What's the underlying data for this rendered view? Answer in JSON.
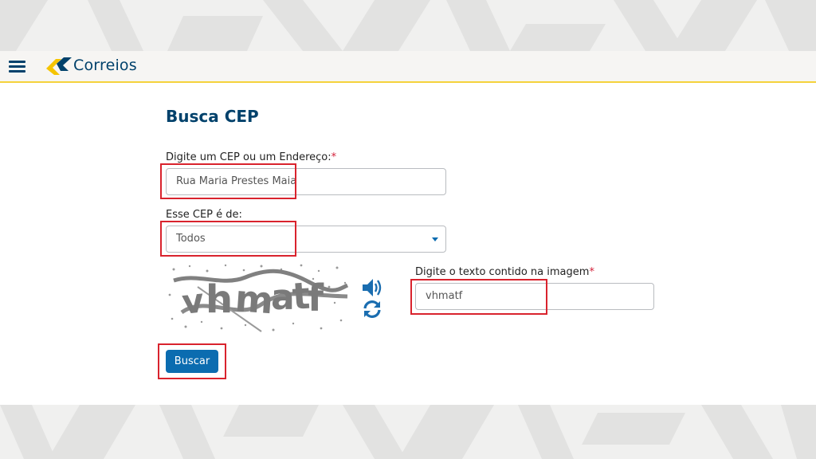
{
  "header": {
    "brand": "Correios"
  },
  "page": {
    "title": "Busca CEP"
  },
  "form": {
    "cep_label": "Digite um CEP ou um Endereço:",
    "cep_required": "*",
    "cep_value": "Rua Maria Prestes Maia",
    "type_label": "Esse CEP é de:",
    "type_value": "Todos",
    "captcha_label": "Digite o texto contido na imagem",
    "captcha_required": "*",
    "captcha_value": "vhmatf",
    "submit_label": "Buscar"
  },
  "icons": {
    "menu": "hamburger-menu-icon",
    "audio": "speaker-icon",
    "refresh": "refresh-icon"
  },
  "colors": {
    "brand_blue": "#00416b",
    "button_blue": "#0b6cb0",
    "brand_yellow": "#f5d23c",
    "highlight_red": "#d9232d"
  }
}
